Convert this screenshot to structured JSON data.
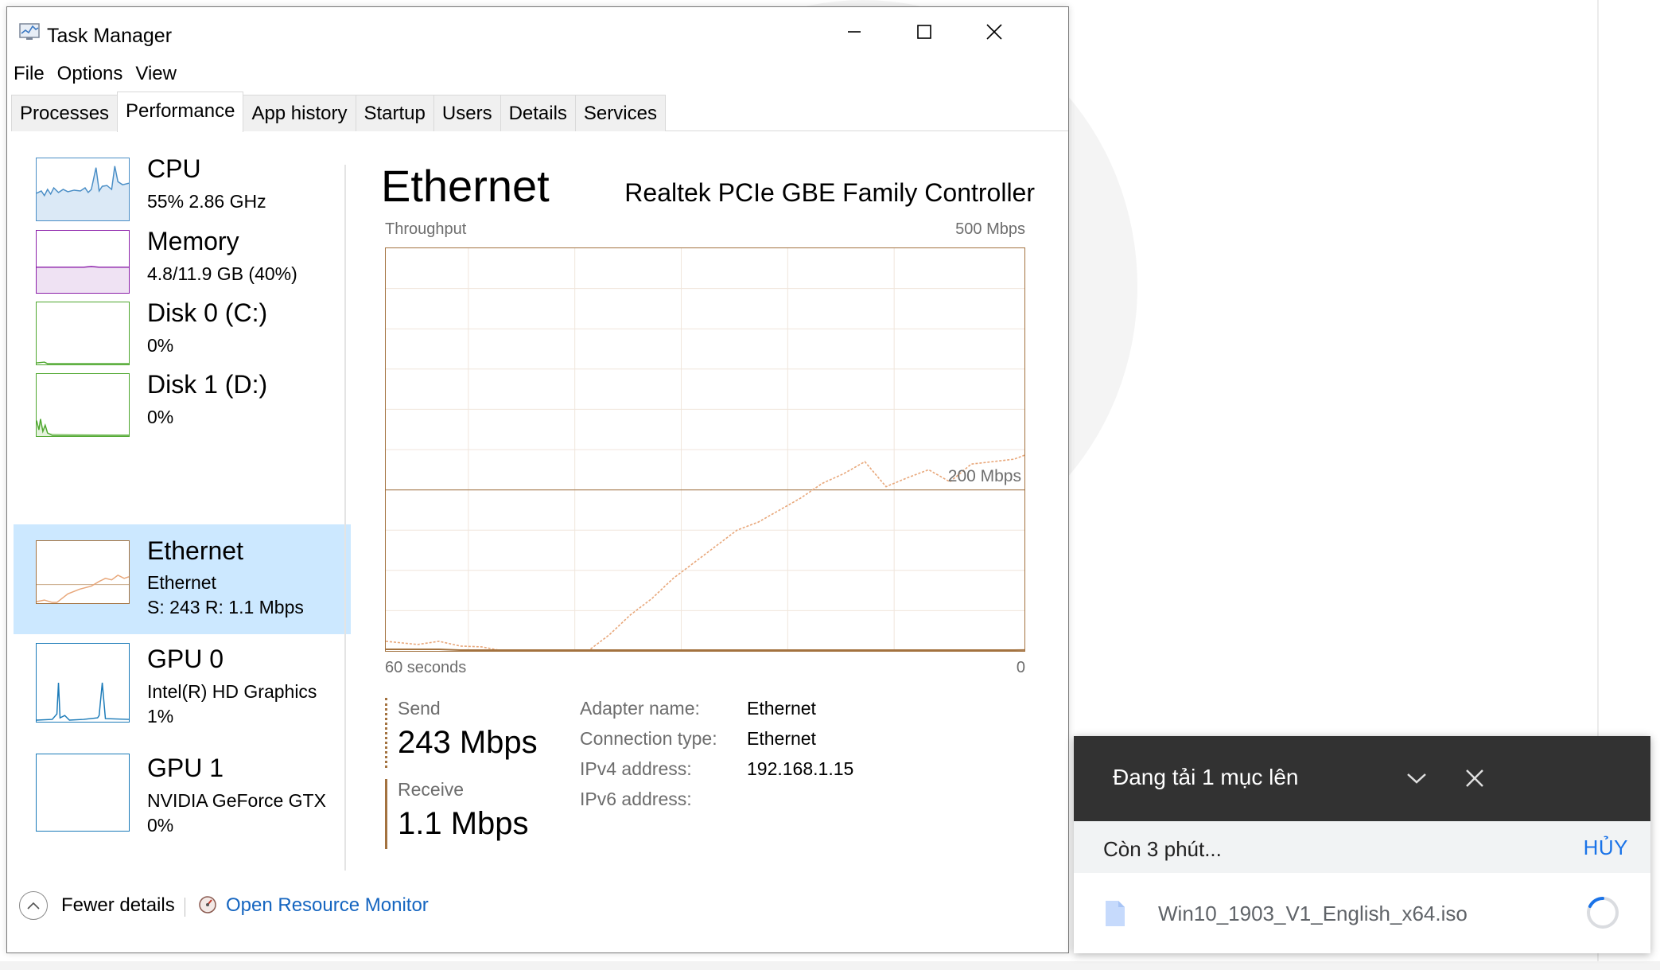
{
  "window": {
    "title": "Task Manager",
    "controls": [
      "minimize",
      "maximize",
      "close"
    ]
  },
  "menu": [
    "File",
    "Options",
    "View"
  ],
  "tabs": [
    "Processes",
    "Performance",
    "App history",
    "Startup",
    "Users",
    "Details",
    "Services"
  ],
  "active_tab": "Performance",
  "sidebar": {
    "items": [
      {
        "name": "CPU",
        "sub1": "55%  2.86 GHz",
        "sub2": "",
        "color": "#4a8ec6"
      },
      {
        "name": "Memory",
        "sub1": "4.8/11.9 GB (40%)",
        "sub2": "",
        "color": "#8b1fa9"
      },
      {
        "name": "Disk 0 (C:)",
        "sub1": "0%",
        "sub2": "",
        "color": "#4ea72e"
      },
      {
        "name": "Disk 1 (D:)",
        "sub1": "0%",
        "sub2": "",
        "color": "#4ea72e"
      },
      {
        "name": "Ethernet",
        "sub1": "Ethernet",
        "sub2": "S: 243  R: 1.1 Mbps",
        "color": "#a3723f",
        "selected": true
      },
      {
        "name": "GPU 0",
        "sub1": "Intel(R) HD Graphics",
        "sub2": "1%",
        "color": "#1a7ab8"
      },
      {
        "name": "GPU 1",
        "sub1": "NVIDIA GeForce GTX",
        "sub2": "0%",
        "color": "#1a7ab8"
      }
    ]
  },
  "main": {
    "title": "Ethernet",
    "adapter": "Realtek PCIe GBE Family Controller",
    "graph_label": "Throughput",
    "graph_max": "500 Mbps",
    "graph_mid": "200 Mbps",
    "time_left": "60 seconds",
    "time_right": "0",
    "send_label": "Send",
    "send_value": "243 Mbps",
    "receive_label": "Receive",
    "receive_value": "1.1 Mbps",
    "info": [
      {
        "key": "Adapter name:",
        "value": "Ethernet"
      },
      {
        "key": "Connection type:",
        "value": "Ethernet"
      },
      {
        "key": "IPv4 address:",
        "value": "192.168.1.15"
      },
      {
        "key": "IPv6 address:",
        "value": ""
      }
    ]
  },
  "footer": {
    "fewer_details": "Fewer details",
    "resource_monitor": "Open Resource Monitor"
  },
  "chart_data": {
    "type": "line",
    "title": "Throughput",
    "xlabel": "60 seconds",
    "ylim": [
      0,
      500
    ],
    "y_max_label": "500 Mbps",
    "y_mid_label": "200 Mbps",
    "grid": true,
    "x": [
      60,
      57,
      55,
      53,
      51,
      49,
      47,
      45,
      43,
      41,
      39,
      37,
      35,
      33,
      31,
      29,
      27,
      25,
      23,
      21,
      19,
      17,
      15,
      13,
      11,
      9,
      7,
      5,
      3,
      1,
      0
    ],
    "series": [
      {
        "name": "Send",
        "values": [
          12,
          8,
          12,
          6,
          5,
          0,
          0,
          0,
          0,
          0,
          20,
          45,
          65,
          90,
          110,
          130,
          150,
          160,
          175,
          190,
          208,
          220,
          235,
          204,
          215,
          225,
          210,
          232,
          235,
          238,
          243
        ]
      },
      {
        "name": "Receive",
        "values": [
          2,
          2,
          2,
          1,
          1,
          1,
          1,
          1,
          1,
          1,
          1,
          1,
          1,
          1,
          1,
          1,
          1,
          1,
          1,
          1,
          1,
          1,
          1,
          1,
          1,
          1,
          1,
          1,
          1,
          1,
          1.1
        ]
      }
    ]
  },
  "upload": {
    "title": "Đang tải 1 mục lên",
    "remaining": "Còn 3 phút...",
    "cancel": "HỦY",
    "file_name": "Win10_1903_V1_English_x64.iso"
  },
  "colors": {
    "ethernet": "#a3723f",
    "selected_bg": "#cce8ff",
    "link": "#1565c0",
    "upload_header": "#323232"
  }
}
